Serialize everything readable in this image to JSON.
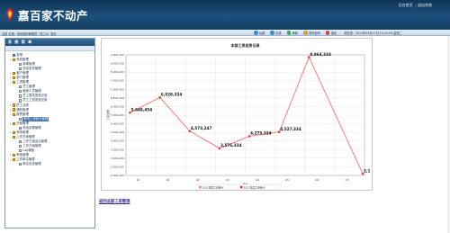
{
  "header": {
    "app_name": "嘉百家不动产",
    "links": [
      "后台首页",
      "退出系统"
    ]
  },
  "toolbar": {
    "breadcrumb": "当前 位置：系统组织管理员（员工A）首页",
    "buttons": [
      {
        "label": "后退",
        "icon": "back-icon",
        "color": "#3a8fd0"
      },
      {
        "label": "前进",
        "icon": "forward-icon",
        "color": "#3a8fd0"
      },
      {
        "label": "刷新",
        "icon": "refresh-icon",
        "color": "#3aa65a"
      },
      {
        "label": "修改密码",
        "icon": "password-icon",
        "color": "#d0a23a"
      },
      {
        "label": "退出",
        "icon": "logout-icon",
        "color": "#c84a3a"
      }
    ],
    "clock": "现在是：2011年09月27日 10:10:59 星期二"
  },
  "sidebar": {
    "title": "系 统 菜 单",
    "items": [
      {
        "label": "菜单",
        "icon": "root-icon",
        "level": 0,
        "toggle": ""
      },
      {
        "label": "系统管理",
        "icon": "folder-icon",
        "level": 0,
        "toggle": "−"
      },
      {
        "label": "新闻管理",
        "icon": "page-icon",
        "level": 1,
        "toggle": ""
      },
      {
        "label": "信息发布管理",
        "icon": "page-icon",
        "level": 1,
        "toggle": ""
      },
      {
        "label": "客户管理",
        "icon": "folder-icon",
        "level": 0,
        "toggle": "+"
      },
      {
        "label": "部门管理",
        "icon": "folder-icon",
        "level": 0,
        "toggle": "+"
      },
      {
        "label": "工资管理",
        "icon": "folder-icon",
        "level": 0,
        "toggle": "−"
      },
      {
        "label": "员工管理",
        "icon": "page-icon",
        "level": 1,
        "toggle": ""
      },
      {
        "label": "租房人员管理",
        "icon": "page-icon",
        "level": 1,
        "toggle": ""
      },
      {
        "label": "员工提成发放记录",
        "icon": "page-icon",
        "level": 1,
        "toggle": ""
      },
      {
        "label": "员工工资发放记录",
        "icon": "page-icon",
        "level": 1,
        "toggle": ""
      },
      {
        "label": "员工业绩",
        "icon": "folder-icon",
        "level": 0,
        "toggle": "+"
      },
      {
        "label": "通知管理",
        "icon": "folder-icon",
        "level": 0,
        "toggle": "+"
      },
      {
        "label": "报表管理",
        "icon": "folder-icon",
        "level": 0,
        "toggle": "−"
      },
      {
        "label": "薪资工资统计管理",
        "icon": "page-icon",
        "level": 1,
        "toggle": "",
        "selected": true
      },
      {
        "label": "日程管理",
        "icon": "folder-icon",
        "level": 0,
        "toggle": "+"
      },
      {
        "label": "系统设置管理",
        "icon": "page-icon",
        "level": 1,
        "toggle": ""
      },
      {
        "label": "审批管理",
        "icon": "folder-icon",
        "level": 0,
        "toggle": "+"
      },
      {
        "label": "工作方案管理",
        "icon": "folder-icon",
        "level": 0,
        "toggle": "−"
      },
      {
        "label": "工作方案会议管理",
        "icon": "page-icon",
        "level": 1,
        "toggle": ""
      },
      {
        "label": "工作方案管理",
        "icon": "page-icon",
        "level": 1,
        "toggle": ""
      },
      {
        "label": "Log模板",
        "icon": "page-icon",
        "level": 1,
        "toggle": ""
      },
      {
        "label": "审批管理",
        "icon": "folder-icon",
        "level": 0,
        "toggle": "+"
      },
      {
        "label": "工作单位管理",
        "icon": "folder-icon",
        "level": 0,
        "toggle": "−"
      },
      {
        "label": "单位信息管理",
        "icon": "page-icon",
        "level": 1,
        "toggle": ""
      }
    ]
  },
  "report_link": "返回总部工资管理",
  "chart_data": {
    "type": "line",
    "title": "本部工资走势记录",
    "xlabel": "月份",
    "ylabel": "工资金额",
    "categories": [
      "12",
      "01",
      "02",
      "03",
      "04",
      "05",
      "06",
      "07"
    ],
    "series": [
      {
        "name": "2011年度工资统计",
        "color": "#ff6f6f",
        "values": [
          5648454,
          6528334,
          4573247,
          3576334,
          4275334,
          4527334,
          8864334,
          2100000
        ]
      },
      {
        "name": "2011年度工资统计",
        "color": "#c92a2a",
        "values": []
      }
    ],
    "data_labels": [
      "5,648,454",
      "6,528,334",
      "4,573,247",
      "3,576,334",
      "4,275,334",
      "4,527,334",
      "8,864,334",
      "2,1"
    ],
    "y_ticks": [
      "2,000,000",
      "2,500,000",
      "3,000,000",
      "3,500,000",
      "4,000,000",
      "4,500,000",
      "5,000,000",
      "5,500,000",
      "6,000,000",
      "6,500,000",
      "7,000,000",
      "7,500,000",
      "8,000,000",
      "8,500,000",
      "9,000,000"
    ],
    "ylim": [
      2000000,
      9000000
    ],
    "grid": true,
    "legend_position": "bottom"
  }
}
